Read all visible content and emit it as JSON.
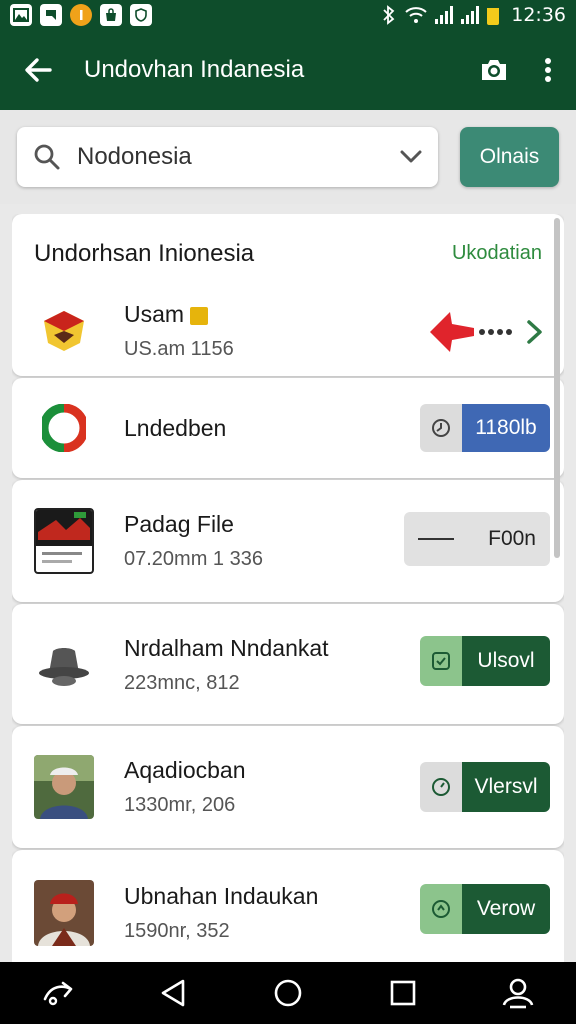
{
  "status_bar": {
    "time": "12:36",
    "icons": [
      "gallery-icon",
      "message-icon",
      "coin-icon",
      "bag-icon",
      "shield-icon"
    ],
    "right_icons": [
      "bluetooth-icon",
      "wifi-icon",
      "signal-icon",
      "signal-icon",
      "battery-icon"
    ]
  },
  "app_bar": {
    "back_icon": "arrow-left-icon",
    "title": "Undovhan Indanesia",
    "camera_icon": "camera-icon",
    "more_icon": "more-vert-icon"
  },
  "search": {
    "value": "Nodonesia",
    "icon": "search-icon",
    "dropdown_icon": "chevron-down-icon"
  },
  "filter_button": {
    "label": "Olnais",
    "color": "#3c8a75"
  },
  "list": {
    "header": {
      "title": "Undorhsan Inionesia",
      "link": "Ukodatian"
    },
    "items": [
      {
        "name": "Usam",
        "meta": "US.am 1156",
        "action": "arrow-more"
      },
      {
        "name": "Lndedben",
        "meta": "",
        "action_label": "1180lb",
        "action_color": "#3f68b4"
      },
      {
        "name": "Padag File",
        "meta": "07.20mm 1 336",
        "action_label": "F00n"
      },
      {
        "name": "Nrdalham Nndankat",
        "meta": "223mnc, 812",
        "action_label": "Ulsovl",
        "action_color": "#1c5a34"
      },
      {
        "name": "Aqadiocban",
        "meta": "1330mr, 206",
        "action_label": "Vlersvl",
        "action_color": "#1c5a34"
      },
      {
        "name": "Ubnahan Indaukan",
        "meta": "1590nr, 352",
        "action_label": "Verow",
        "action_color": "#1c5a34"
      }
    ]
  },
  "nav_bar": {
    "icons": [
      "share-icon",
      "back-triangle-icon",
      "home-circle-icon",
      "recents-square-icon",
      "account-icon"
    ]
  }
}
